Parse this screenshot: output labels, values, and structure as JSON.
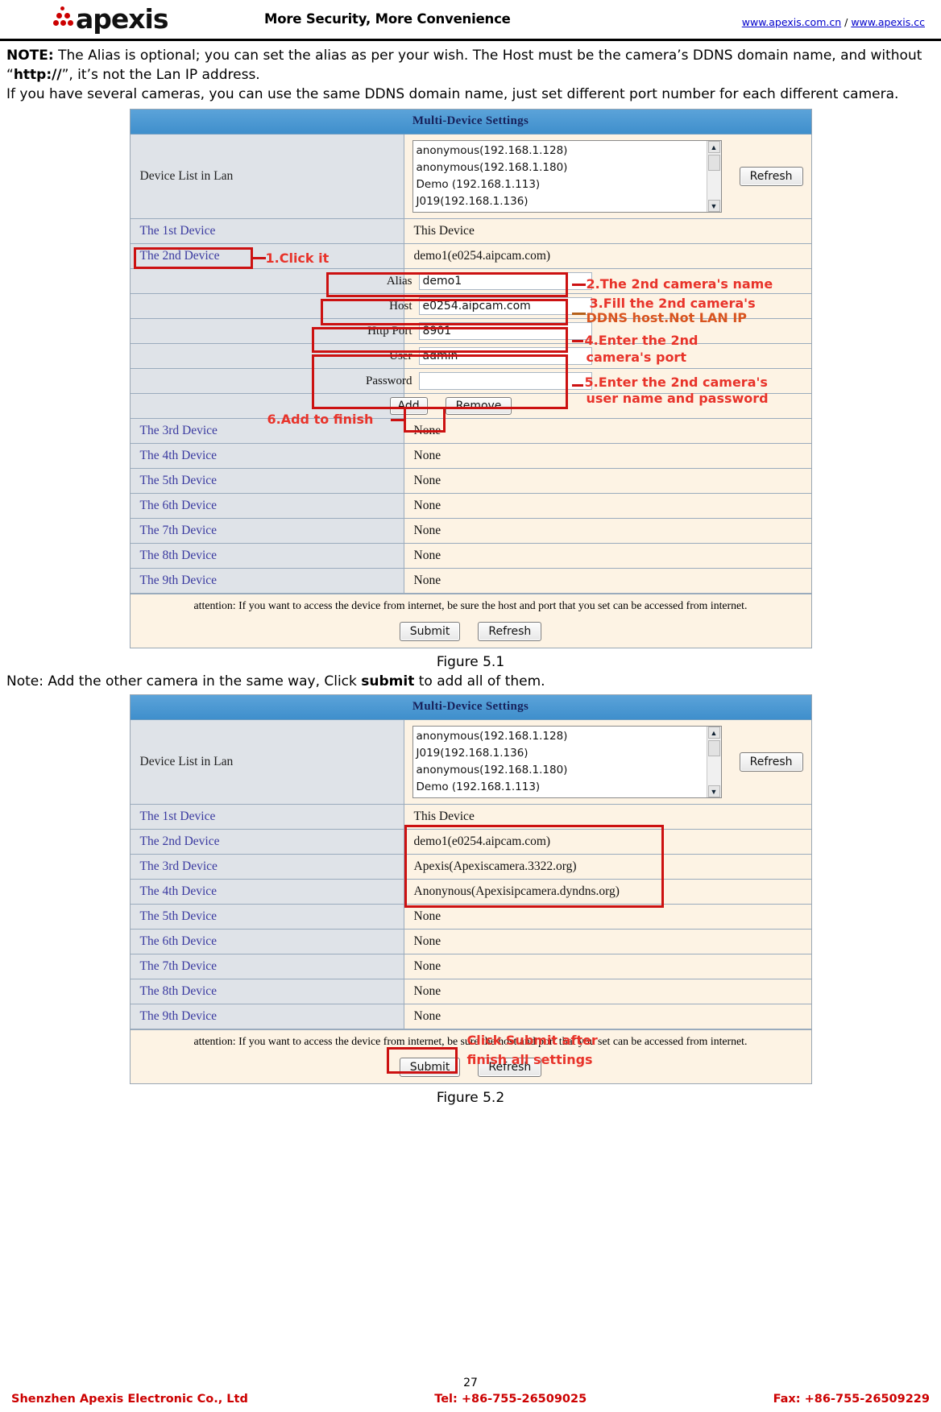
{
  "header": {
    "brand": "apexis",
    "tagline": "More Security, More Convenience",
    "link1": "www.apexis.com.cn",
    "link_sep": " / ",
    "link2": "www.apexis.cc"
  },
  "note": {
    "label": "NOTE:",
    "line1_a": " The Alias is optional; you can set the alias as per your wish. The Host must be the camera’s DDNS domain name, and without “",
    "line1_b": "http://",
    "line1_c": "”, it’s not the Lan IP address.",
    "line2": "If you have several cameras, you can use the same DDNS domain name, just set different port number for each different camera."
  },
  "fig1": {
    "title": "Multi-Device Settings",
    "device_list_label": "Device List in Lan",
    "device_list_items": [
      "anonymous(192.168.1.128)",
      "anonymous(192.168.1.180)",
      "Demo (192.168.1.113)",
      "J019(192.168.1.136)"
    ],
    "refresh_label": "Refresh",
    "rows": [
      {
        "label": "The 1st Device",
        "value": "This Device"
      },
      {
        "label": "The 2nd Device",
        "value": "demo1(e0254.aipcam.com)"
      },
      {
        "label": "The 3rd Device",
        "value": "None"
      },
      {
        "label": "The 4th Device",
        "value": "None"
      },
      {
        "label": "The 5th Device",
        "value": "None"
      },
      {
        "label": "The 6th Device",
        "value": "None"
      },
      {
        "label": "The 7th Device",
        "value": "None"
      },
      {
        "label": "The 8th Device",
        "value": "None"
      },
      {
        "label": "The 9th Device",
        "value": "None"
      }
    ],
    "fields": [
      {
        "label": "Alias",
        "value": "demo1"
      },
      {
        "label": "Host",
        "value": "e0254.aipcam.com"
      },
      {
        "label": "Http Port",
        "value": "8901"
      },
      {
        "label": "User",
        "value": "admin"
      },
      {
        "label": "Password",
        "value": ""
      }
    ],
    "add_label": "Add",
    "remove_label": "Remove",
    "attention": "attention: If you want to access the device from internet, be sure the host and port that you set can be accessed from internet.",
    "submit_label": "Submit",
    "refresh2_label": "Refresh",
    "annotations": {
      "a1": "1.Click it",
      "a2": "2.The 2nd camera's name",
      "a3_line1": "3.Fill the 2nd camera's",
      "a3_line2": "DDNS host.Not LAN IP",
      "a4_line1": "4.Enter the 2nd",
      "a4_line2": "camera's port",
      "a5_line1": "5.Enter the 2nd camera's",
      "a5_line2": "user name and password",
      "a6": "6.Add to finish"
    },
    "caption": "Figure 5.1"
  },
  "mid_note": {
    "a": "Note: Add the other camera in the same way, Click ",
    "b": "submit",
    "c": " to add all of them."
  },
  "fig2": {
    "title": "Multi-Device Settings",
    "device_list_label": "Device List in Lan",
    "device_list_items": [
      "anonymous(192.168.1.128)",
      "J019(192.168.1.136)",
      "anonymous(192.168.1.180)",
      "Demo (192.168.1.113)"
    ],
    "refresh_label": "Refresh",
    "rows": [
      {
        "label": "The 1st Device",
        "value": "This Device"
      },
      {
        "label": "The 2nd Device",
        "value": "demo1(e0254.aipcam.com)"
      },
      {
        "label": "The 3rd Device",
        "value": "Apexis(Apexiscamera.3322.org)"
      },
      {
        "label": "The 4th Device",
        "value": "Anonynous(Apexisipcamera.dyndns.org)"
      },
      {
        "label": "The 5th Device",
        "value": "None"
      },
      {
        "label": "The 6th Device",
        "value": "None"
      },
      {
        "label": "The 7th Device",
        "value": "None"
      },
      {
        "label": "The 8th Device",
        "value": "None"
      },
      {
        "label": "The 9th Device",
        "value": "None"
      }
    ],
    "attention": "attention: If you want to access the device from internet, be sure the host and port that you set can be accessed from internet.",
    "submit_label": "Submit",
    "refresh2_label": "Refresh",
    "annotations": {
      "b1_line1": "Click Submit after",
      "b1_line2": "finish all settings"
    },
    "caption": "Figure 5.2"
  },
  "footer": {
    "page": "27",
    "company": "Shenzhen Apexis Electronic Co., Ltd",
    "tel": "Tel: +86-755-26509025",
    "fax": "Fax: +86-755-26509229"
  },
  "colors": {
    "accent_red": "#cc1111",
    "annotation_red": "#e8332a",
    "brand_red": "#cc0000",
    "link_blue": "#0000cc",
    "title_blue": "#3f8fcc"
  }
}
